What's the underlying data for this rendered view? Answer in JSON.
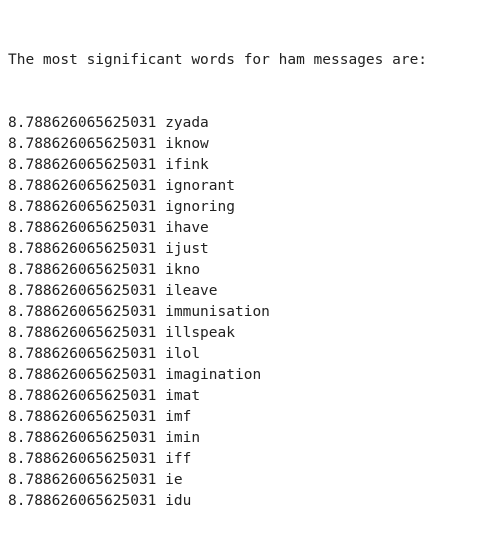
{
  "output": {
    "heading": "The most significant words for ham messages are:",
    "rows": [
      {
        "score": "8.788626065625031",
        "word": "zyada"
      },
      {
        "score": "8.788626065625031",
        "word": "iknow"
      },
      {
        "score": "8.788626065625031",
        "word": "ifink"
      },
      {
        "score": "8.788626065625031",
        "word": "ignorant"
      },
      {
        "score": "8.788626065625031",
        "word": "ignoring"
      },
      {
        "score": "8.788626065625031",
        "word": "ihave"
      },
      {
        "score": "8.788626065625031",
        "word": "ijust"
      },
      {
        "score": "8.788626065625031",
        "word": "ikno"
      },
      {
        "score": "8.788626065625031",
        "word": "ileave"
      },
      {
        "score": "8.788626065625031",
        "word": "immunisation"
      },
      {
        "score": "8.788626065625031",
        "word": "illspeak"
      },
      {
        "score": "8.788626065625031",
        "word": "ilol"
      },
      {
        "score": "8.788626065625031",
        "word": "imagination"
      },
      {
        "score": "8.788626065625031",
        "word": "imat"
      },
      {
        "score": "8.788626065625031",
        "word": "imf"
      },
      {
        "score": "8.788626065625031",
        "word": "imin"
      },
      {
        "score": "8.788626065625031",
        "word": "iff"
      },
      {
        "score": "8.788626065625031",
        "word": "ie"
      },
      {
        "score": "8.788626065625031",
        "word": "idu"
      }
    ]
  }
}
